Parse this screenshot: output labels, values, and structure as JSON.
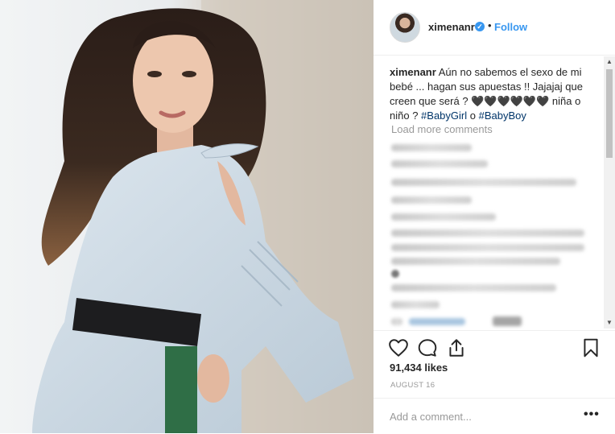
{
  "post": {
    "photo_alt": "Woman in light blue ruffled blouse with black belt leaning on a stone wall"
  },
  "header": {
    "username": "ximenanr",
    "verified_glyph": "✓",
    "separator": "•",
    "follow_label": "Follow"
  },
  "caption": {
    "username": "ximenanr",
    "text_part1": "Aún no sabemos el sexo de mi bebé ... hagan sus apuestas !! Jajajaj que creen que será ? 🖤🖤🖤🖤🖤🖤 niña o niño ? ",
    "hashtag1": "#BabyGirl",
    "connector": " o ",
    "hashtag2": "#BabyBoy"
  },
  "comments": {
    "load_more_label": "Load more comments"
  },
  "scrollbar": {
    "up_glyph": "▲",
    "down_glyph": "▼"
  },
  "actions": {
    "like_icon": "heart-icon",
    "comment_icon": "comment-icon",
    "share_icon": "share-icon",
    "save_icon": "bookmark-icon"
  },
  "likes": {
    "text": "91,434 likes"
  },
  "date": {
    "text": "AUGUST 16"
  },
  "add_comment": {
    "placeholder": "Add a comment...",
    "more_glyph": "•••"
  },
  "colors": {
    "link_blue": "#3897f0",
    "hashtag_blue": "#003569",
    "muted_gray": "#999999"
  }
}
